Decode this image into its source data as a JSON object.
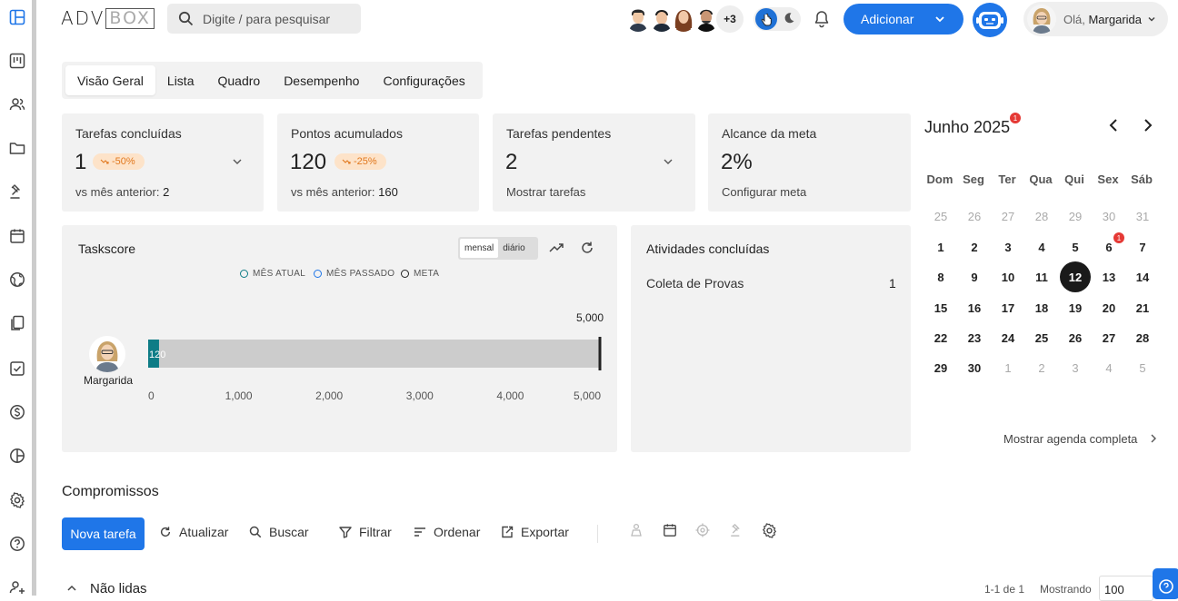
{
  "header": {
    "logo_left": "ADV",
    "logo_right": "BOX",
    "search_placeholder": "Digite / para pesquisar",
    "extra_users": "+3",
    "add_label": "Adicionar",
    "greeting": "Olá,",
    "user_name": "Margarida"
  },
  "tabs": [
    {
      "label": "Visão Geral",
      "active": true
    },
    {
      "label": "Lista"
    },
    {
      "label": "Quadro"
    },
    {
      "label": "Desempenho"
    },
    {
      "label": "Configurações"
    }
  ],
  "cards": [
    {
      "title": "Tarefas concluídas",
      "value": "1",
      "badge": "-50%",
      "sub_prefix": "vs mês anterior:",
      "sub_value": "2"
    },
    {
      "title": "Pontos acumulados",
      "value": "120",
      "badge": "-25%",
      "sub_prefix": "vs mês anterior:",
      "sub_value": "160"
    },
    {
      "title": "Tarefas pendentes",
      "value": "2",
      "sub_prefix": "Mostrar tarefas"
    },
    {
      "title": "Alcance da meta",
      "value": "2%",
      "sub_prefix": "Configurar meta"
    }
  ],
  "taskscore": {
    "title": "Taskscore",
    "toggle": [
      "mensal",
      "diário"
    ],
    "legend": [
      "MÊS ATUAL",
      "MÊS PASSADO",
      "META"
    ],
    "person": "Margarida"
  },
  "chart_data": {
    "type": "bar",
    "orientation": "horizontal",
    "categories": [
      "Margarida"
    ],
    "series": [
      {
        "name": "MÊS ATUAL",
        "values": [
          120
        ],
        "color": "#0e7c86"
      },
      {
        "name": "MÊS PASSADO",
        "values": [
          5000
        ],
        "color": "#cccccc"
      }
    ],
    "meta_value": 5000,
    "meta_label": "5,000",
    "bar_label": "120",
    "xlim": [
      0,
      5000
    ],
    "xticks": [
      "0",
      "1,000",
      "2,000",
      "3,000",
      "4,000",
      "5,000"
    ]
  },
  "atividades": {
    "title": "Atividades concluídas",
    "items": [
      {
        "label": "Coleta de Provas",
        "count": "1"
      }
    ]
  },
  "calendar": {
    "month_label": "Junho 2025",
    "month_badge": "1",
    "weekdays": [
      "Dom",
      "Seg",
      "Ter",
      "Qua",
      "Qui",
      "Sex",
      "Sáb"
    ],
    "weeks": [
      [
        "25",
        "26",
        "27",
        "28",
        "29",
        "30",
        "31"
      ],
      [
        "1",
        "2",
        "3",
        "4",
        "5",
        "6",
        "7"
      ],
      [
        "8",
        "9",
        "10",
        "11",
        "12",
        "13",
        "14"
      ],
      [
        "15",
        "16",
        "17",
        "18",
        "19",
        "20",
        "21"
      ],
      [
        "22",
        "23",
        "24",
        "25",
        "26",
        "27",
        "28"
      ],
      [
        "29",
        "30",
        "1",
        "2",
        "3",
        "4",
        "5"
      ]
    ],
    "today": "12",
    "event_day": "6",
    "event_badge": "1",
    "show_all": "Mostrar agenda completa"
  },
  "compromissos": {
    "title": "Compromissos",
    "new_task": "Nova tarefa",
    "actions": [
      "Atualizar",
      "Buscar",
      "Filtrar",
      "Ordenar",
      "Exportar"
    ],
    "section": "Não lidas",
    "pagination": "1-1 de 1",
    "showing_label": "Mostrando",
    "page_size": "100"
  },
  "colors": {
    "accent": "#1f76e8",
    "bar_current": "#0e7c86",
    "badge_bg": "#fde3c9",
    "badge_text": "#e1781e",
    "alert": "#e53935"
  }
}
